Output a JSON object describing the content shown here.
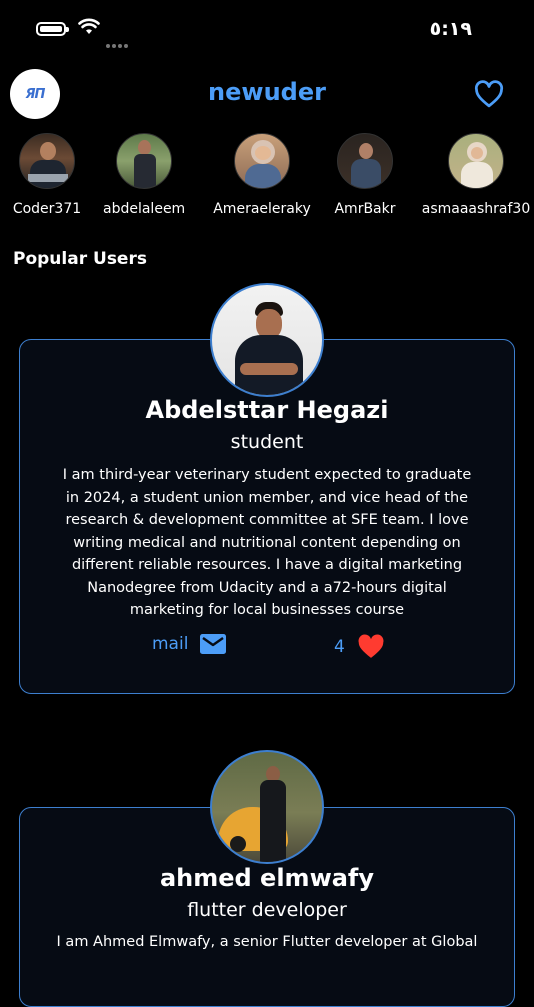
{
  "status_bar": {
    "time": "٥:١٩",
    "battery_icon": "battery-icon",
    "wifi_icon": "wifi-icon"
  },
  "header": {
    "logo_text": "ЯΠ",
    "title": "newuder",
    "favorite_icon": "heart-outline-icon"
  },
  "stories": [
    {
      "name": "Coder371"
    },
    {
      "name": "abdelaleem"
    },
    {
      "name": "Ameraeleraky"
    },
    {
      "name": "AmrBakr"
    },
    {
      "name": "asmaaashraf30"
    }
  ],
  "section_title": "Popular Users",
  "users": [
    {
      "name": "Abdelsttar Hegazi",
      "role": "student",
      "bio": "I am third-year veterinary student expected to graduate in 2024, a student union member, and vice head of the research & development committee at SFE team. I love writing medical and nutritional content depending on different reliable resources. I have a digital marketing Nanodegree from Udacity and a a72-hours digital marketing for local businesses course",
      "mail_label": "mail",
      "likes": "4"
    },
    {
      "name": "ahmed elmwafy",
      "role": "flutter developer",
      "bio": "I am Ahmed Elmwafy, a senior Flutter developer at Global"
    }
  ],
  "colors": {
    "accent": "#4c9df7",
    "card_border": "#3d7fcf",
    "heart": "#ff3b30",
    "background": "#000000"
  }
}
